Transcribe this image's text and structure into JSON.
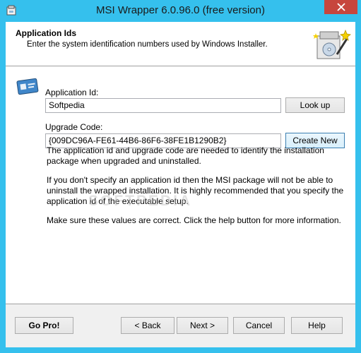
{
  "window": {
    "title": "MSI Wrapper 6.0.96.0 (free version)",
    "titlebar_color": "#35c0ed",
    "close_color": "#c7463d",
    "app_icon": "msi-app-icon",
    "close_icon": "close-icon"
  },
  "header": {
    "title": "Application Ids",
    "subtitle": "Enter the system identification numbers used by Windows Installer.",
    "icon": "wizard-install-icon"
  },
  "form": {
    "side_icon": "id-card-icon",
    "app_id_label": "Application Id:",
    "app_id_value": "Softpedia",
    "lookup_label": "Look up",
    "upgrade_code_label": "Upgrade Code:",
    "upgrade_code_value": "{009DC96A-FE61-44B6-86F6-38FE1B1290B2}",
    "create_new_label": "Create New"
  },
  "info": {
    "para1": "The application id and upgrade code are needed to identify the installation package when upgraded and uninstalled.",
    "para2": "If you don't specify an application id then the MSI package will not be able to uninstall the wrapped installation. It is highly recommended that you specify the application id of the executable setup.",
    "para3": "Make sure these values are correct. Click the help button for more information."
  },
  "watermark": "SOFTPEDIA",
  "footer": {
    "gopro_label": "Go Pro!",
    "back_label": "< Back",
    "next_label": "Next >",
    "cancel_label": "Cancel",
    "help_label": "Help"
  }
}
